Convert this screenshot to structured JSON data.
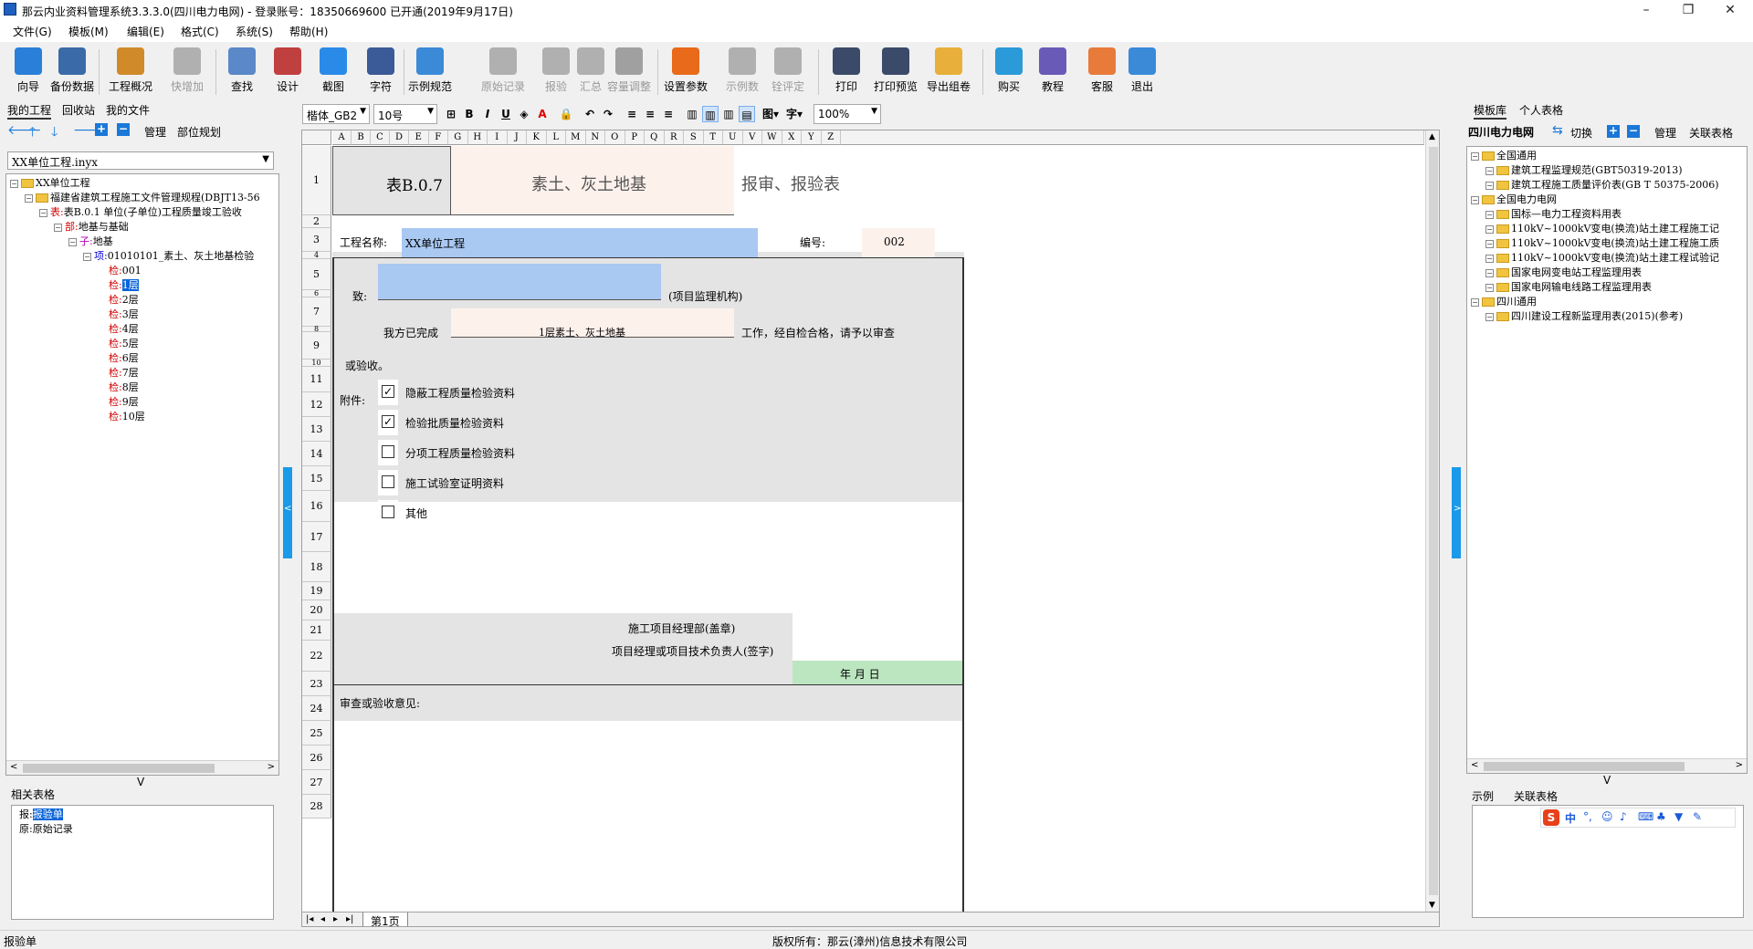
{
  "window": {
    "title": "那云内业资料管理系统3.3.3.0(四川电力电网) - 登录账号：18350669600 已开通(2019年9月17日)",
    "minimize": "–",
    "maximize": "❐",
    "close": "✕"
  },
  "menu": [
    "文件(G)",
    "模板(M)",
    "编辑(E)",
    "格式(C)",
    "系统(S)",
    "帮助(H)"
  ],
  "toolbar": [
    {
      "label": "向导",
      "color": "#2a7fd8",
      "enabled": true
    },
    {
      "label": "备份数据",
      "color": "#3a6aa8",
      "enabled": true
    },
    {
      "label": "工程概况",
      "color": "#d08a2a",
      "enabled": true
    },
    {
      "label": "快增加",
      "color": "#b0b0b0",
      "enabled": false
    },
    {
      "label": "查找",
      "color": "#5a88c8",
      "enabled": true
    },
    {
      "label": "设计",
      "color": "#c04040",
      "enabled": true
    },
    {
      "label": "截图",
      "color": "#2a8ae8",
      "enabled": true
    },
    {
      "label": "字符",
      "color": "#3a5a98",
      "enabled": true
    },
    {
      "label": "示例规范",
      "color": "#3a8ad8",
      "enabled": true
    },
    {
      "label": "原始记录",
      "color": "#b0b0b0",
      "enabled": false
    },
    {
      "label": "报验",
      "color": "#b0b0b0",
      "enabled": false
    },
    {
      "label": "汇总",
      "color": "#b0b0b0",
      "enabled": false
    },
    {
      "label": "容量调整",
      "color": "#a0a0a0",
      "enabled": false
    },
    {
      "label": "设置参数",
      "color": "#e86a1a",
      "enabled": true
    },
    {
      "label": "示例数",
      "color": "#b0b0b0",
      "enabled": false
    },
    {
      "label": "铨评定",
      "color": "#b0b0b0",
      "enabled": false
    },
    {
      "label": "打印",
      "color": "#3a4a68",
      "enabled": true
    },
    {
      "label": "打印预览",
      "color": "#3a4a68",
      "enabled": true
    },
    {
      "label": "导出组卷",
      "color": "#e8b03a",
      "enabled": true
    },
    {
      "label": "购买",
      "color": "#2a9ad8",
      "enabled": true
    },
    {
      "label": "教程",
      "color": "#6a5ab8",
      "enabled": true
    },
    {
      "label": "客服",
      "color": "#e87a3a",
      "enabled": true
    },
    {
      "label": "退出",
      "color": "#3a8ad8",
      "enabled": true
    }
  ],
  "left": {
    "tabs": [
      "我的工程",
      "回收站",
      "我的文件"
    ],
    "actions": [
      "管理",
      "部位规划"
    ],
    "project_file": "XX单位工程.inyx",
    "tree": [
      {
        "indent": 0,
        "kind": "folder",
        "text": "XX单位工程"
      },
      {
        "indent": 1,
        "kind": "folder",
        "text": "福建省建筑工程施工文件管理规程(DBJT13-56"
      },
      {
        "indent": 2,
        "kind": "tag",
        "tag": "表",
        "tagcolor": "red",
        "text": "表B.0.1  单位(子单位)工程质量竣工验收"
      },
      {
        "indent": 3,
        "kind": "tag",
        "tag": "部",
        "tagcolor": "red",
        "text": "地基与基础"
      },
      {
        "indent": 4,
        "kind": "tag",
        "tag": "子",
        "tagcolor": "mag",
        "text": "地基"
      },
      {
        "indent": 5,
        "kind": "tag",
        "tag": "项",
        "tagcolor": "blue",
        "text": "01010101_素土、灰土地基检验"
      },
      {
        "indent": 6,
        "kind": "leaf",
        "tag": "检",
        "tagcolor": "red",
        "text": "001"
      },
      {
        "indent": 6,
        "kind": "leaf",
        "tag": "检",
        "tagcolor": "red",
        "text": "1层",
        "selected": true
      },
      {
        "indent": 6,
        "kind": "leaf",
        "tag": "检",
        "tagcolor": "red",
        "text": "2层"
      },
      {
        "indent": 6,
        "kind": "leaf",
        "tag": "检",
        "tagcolor": "red",
        "text": "3层"
      },
      {
        "indent": 6,
        "kind": "leaf",
        "tag": "检",
        "tagcolor": "red",
        "text": "4层"
      },
      {
        "indent": 6,
        "kind": "leaf",
        "tag": "检",
        "tagcolor": "red",
        "text": "5层"
      },
      {
        "indent": 6,
        "kind": "leaf",
        "tag": "检",
        "tagcolor": "red",
        "text": "6层"
      },
      {
        "indent": 6,
        "kind": "leaf",
        "tag": "检",
        "tagcolor": "red",
        "text": "7层"
      },
      {
        "indent": 6,
        "kind": "leaf",
        "tag": "检",
        "tagcolor": "red",
        "text": "8层"
      },
      {
        "indent": 6,
        "kind": "leaf",
        "tag": "检",
        "tagcolor": "red",
        "text": "9层"
      },
      {
        "indent": 6,
        "kind": "leaf",
        "tag": "检",
        "tagcolor": "red",
        "text": "10层"
      }
    ],
    "related_title": "相关表格",
    "related": [
      {
        "tag": "报",
        "text": "报验单",
        "selected": true
      },
      {
        "tag": "原",
        "text": "原始记录"
      }
    ]
  },
  "format_bar": {
    "font": "楷体_GB2",
    "size": "10号",
    "zoom": "100%"
  },
  "sheet": {
    "columns": [
      "A",
      "B",
      "C",
      "D",
      "E",
      "F",
      "G",
      "H",
      "I",
      "J",
      "K",
      "L",
      "M",
      "N",
      "O",
      "P",
      "Q",
      "R",
      "S",
      "T",
      "U",
      "V",
      "W",
      "X",
      "Y",
      "Z"
    ],
    "rows": [
      "1",
      "2",
      "3",
      "4",
      "5",
      "6",
      "7",
      "8",
      "9",
      "10",
      "11",
      "12",
      "13",
      "14",
      "15",
      "16",
      "17",
      "18",
      "19",
      "20",
      "21",
      "22",
      "23",
      "24",
      "25",
      "26",
      "27",
      "28"
    ],
    "form_code": "表B.0.7",
    "title1": "素土、灰土地基",
    "title2": "报审、报验表",
    "project_name_label": "工程名称:",
    "project_name": "XX单位工程",
    "number_label": "编号:",
    "number": "002",
    "to_label": "致:",
    "to_suffix": "(项目监理机构)",
    "completed_label": "我方已完成",
    "completed_value": "1层素土、灰土地基",
    "completed_suffix": "工作，经自检合格，请予以审查",
    "completed_tail": "或验收。",
    "attach_label": "附件:",
    "attachments": [
      {
        "text": "隐蔽工程质量检验资料",
        "checked": true
      },
      {
        "text": "检验批质量检验资料",
        "checked": true
      },
      {
        "text": "分项工程质量检验资料",
        "checked": false
      },
      {
        "text": "施工试验室证明资料",
        "checked": false
      },
      {
        "text": "其他",
        "checked": false
      }
    ],
    "sign1": "施工项目经理部(盖章)",
    "sign2": "项目经理或项目技术负责人(签字)",
    "date": "年   月   日",
    "review_label": "审查或验收意见:",
    "sheet_tab": "第1页"
  },
  "right": {
    "tabs": [
      "模板库",
      "个人表格"
    ],
    "current": "四川电力电网",
    "actions": [
      "切换",
      "管理",
      "关联表格"
    ],
    "tree": [
      {
        "indent": 0,
        "kind": "folder",
        "text": "全国通用"
      },
      {
        "indent": 1,
        "kind": "folder",
        "text": "建筑工程监理规范(GBT50319-2013)"
      },
      {
        "indent": 1,
        "kind": "folder",
        "text": "建筑工程施工质量评价表(GB T 50375-2006)"
      },
      {
        "indent": 0,
        "kind": "folder",
        "text": "全国电力电网"
      },
      {
        "indent": 1,
        "kind": "folder",
        "text": "国标—电力工程资料用表"
      },
      {
        "indent": 1,
        "kind": "folder",
        "text": "110kV~1000kV变电(换流)站土建工程施工记"
      },
      {
        "indent": 1,
        "kind": "folder",
        "text": "110kV~1000kV变电(换流)站土建工程施工质"
      },
      {
        "indent": 1,
        "kind": "folder",
        "text": "110kV~1000kV变电(换流)站土建工程试验记"
      },
      {
        "indent": 1,
        "kind": "folder",
        "text": "国家电网变电站工程监理用表"
      },
      {
        "indent": 1,
        "kind": "folder",
        "text": "国家电网输电线路工程监理用表"
      },
      {
        "indent": 0,
        "kind": "folder",
        "text": "四川通用"
      },
      {
        "indent": 1,
        "kind": "folder",
        "text": "四川建设工程新监理用表(2015)(参考)"
      }
    ],
    "bottom_tabs": [
      "示例",
      "关联表格"
    ],
    "ime_label": "中"
  },
  "status": {
    "left": "报验单",
    "center": "版权所有：那云(漳州)信息技术有限公司"
  }
}
